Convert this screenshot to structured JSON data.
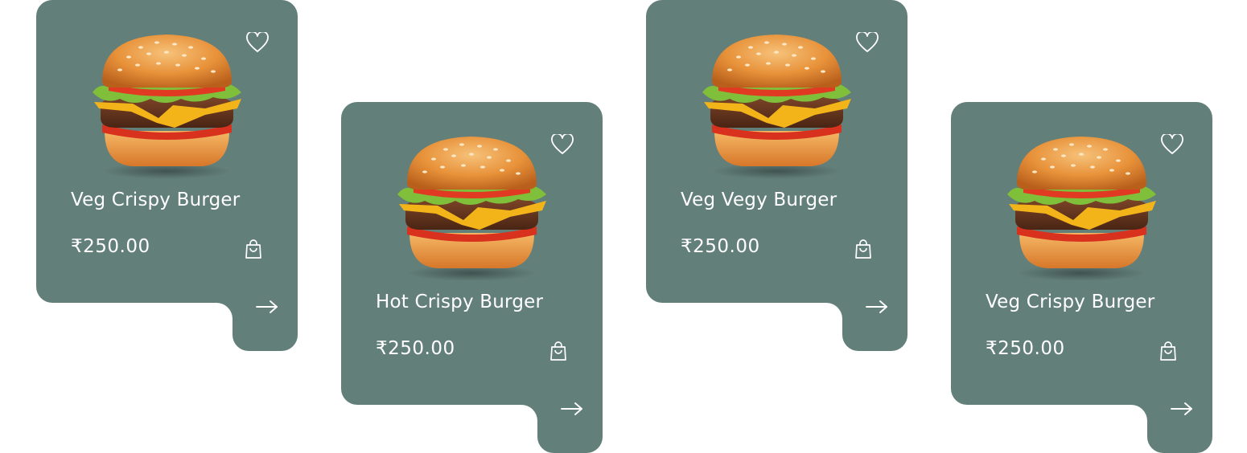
{
  "theme": {
    "card_color": "#637f79",
    "text_color": "#ffffff"
  },
  "products": [
    {
      "name": "Veg Crispy Burger",
      "price": "₹250.00",
      "image_icon": "burger-image",
      "favorite_icon": "heart-outline-icon",
      "cart_icon": "shopping-bag-icon",
      "next_icon": "arrow-right-icon"
    },
    {
      "name": "Hot Crispy Burger",
      "price": "₹250.00",
      "image_icon": "burger-image",
      "favorite_icon": "heart-outline-icon",
      "cart_icon": "shopping-bag-icon",
      "next_icon": "arrow-right-icon"
    },
    {
      "name": "Veg Vegy Burger",
      "price": "₹250.00",
      "image_icon": "burger-image",
      "favorite_icon": "heart-outline-icon",
      "cart_icon": "shopping-bag-icon",
      "next_icon": "arrow-right-icon"
    },
    {
      "name": "Veg Crispy Burger",
      "price": "₹250.00",
      "image_icon": "burger-image",
      "favorite_icon": "heart-outline-icon",
      "cart_icon": "shopping-bag-icon",
      "next_icon": "arrow-right-icon"
    }
  ]
}
